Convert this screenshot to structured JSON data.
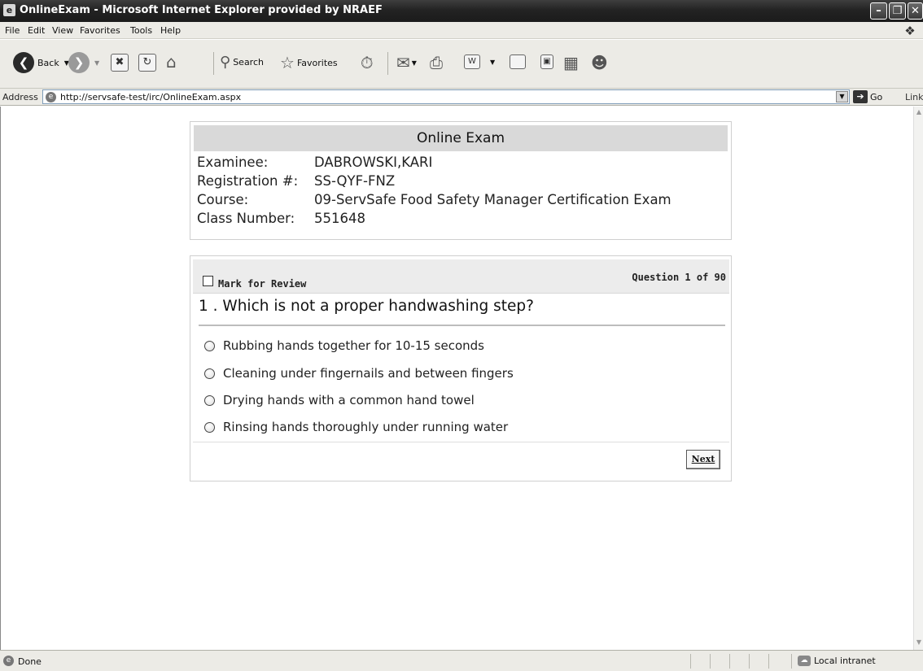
{
  "window": {
    "title": "OnlineExam - Microsoft Internet Explorer provided by NRAEF",
    "title_icon": "ie-page-icon"
  },
  "menu": [
    "File",
    "Edit",
    "View",
    "Favorites",
    "Tools",
    "Help"
  ],
  "toolbar": {
    "back_label": "Back",
    "search_label": "Search",
    "favorites_label": "Favorites"
  },
  "address": {
    "label": "Address",
    "url": "http://servsafe-test/irc/OnlineExam.aspx",
    "go_label": "Go",
    "links_label": "Link"
  },
  "exam_info": {
    "header": "Online Exam",
    "rows": [
      {
        "label": "Examinee:",
        "value": "DABROWSKI,KARI"
      },
      {
        "label": "Registration #:",
        "value": "SS-QYF-FNZ"
      },
      {
        "label": "Course:",
        "value": "09-ServSafe Food Safety Manager Certification Exam"
      },
      {
        "label": "Class Number:",
        "value": "551648"
      }
    ]
  },
  "question": {
    "review_label": "Mark for Review",
    "review_checked": false,
    "counter": "Question 1 of 90",
    "text": "1 . Which is not a proper handwashing step?",
    "options": [
      "Rubbing hands together for 10-15 seconds",
      "Cleaning under fingernails and between fingers",
      "Drying hands with a common hand towel",
      "Rinsing hands thoroughly under running water"
    ],
    "next_label": "Next"
  },
  "status": {
    "text": "Done",
    "zone": "Local intranet"
  }
}
